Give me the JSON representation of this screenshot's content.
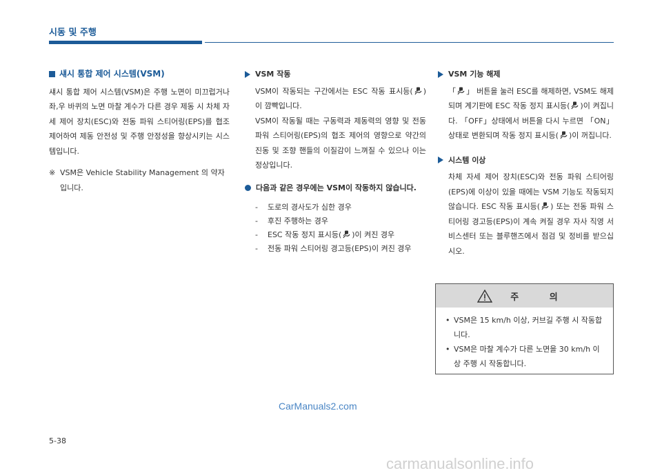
{
  "header": {
    "section": "시동 및 주행"
  },
  "left": {
    "title": "섀시 통합 제어 시스템(VSM)",
    "body": "섀시 통합 제어 시스템(VSM)은 주행 노면이 미끄럽거나 좌,우 바퀴의 노면 마찰 계수가 다른 경우 제동 시 차체 자세 제어 장치(ESC)와 전동 파워 스티어링(EPS)를 협조 제어하여 제동 안전성 및 주행 안정성을 향상시키는 시스템입니다.",
    "note_mark": "※",
    "note": "VSM은 Vehicle Stability Management 의 약자입니다."
  },
  "middle": {
    "title": "VSM 작동",
    "p1a": "VSM이 작동되는 구간에서는 ESC 작동 표시등(",
    "p1b": ")이 깜빡입니다.",
    "p2": "VSM이 작동될 때는 구동력과 제동력의 영향 및 전동 파워 스티어링(EPS)의 협조 제어의 영향으로 약간의 진동 및 조향 핸들의 이질감이 느껴질 수 있으나 이는 정상입니다.",
    "dot_heading": "다음과 같은 경우에는 VSM이 작동하지 않습니다.",
    "dash": "-",
    "cases": [
      "도로의 경사도가 심한 경우",
      "후진 주행하는 경우"
    ],
    "case3a": "ESC 작동 정지 표시등(",
    "case3b": ")이 켜진 경우",
    "case4": "전동 파워 스티어링 경고등(EPS)이 켜진 경우"
  },
  "right": {
    "title1": "VSM 기능 해제",
    "p1a": "「",
    "p1b": "」 버튼을 눌러 ESC를 해제하면, VSM도 해제되며 계기판에 ESC 작동 정지 표시등(",
    "p1c": ")이 켜집니다. 「OFF」상태에서 버튼을 다시 누르면 「ON」상태로 변환되며 작동 정지 표시등(",
    "p1d": ")이 꺼집니다.",
    "title2": "시스템 이상",
    "p2a": "차체 자세 제어 장치(ESC)와 전동 파워 스티어링(EPS)에 이상이 있을 때에는 VSM 기능도 작동되지 않습니다. ESC 작동 표시등(",
    "p2b": ") 또는 전동 파워 스티어링 경고등(EPS)이 계속 켜질 경우 자사 직영 서비스센터 또는 블루핸즈에서 점검 및 정비를 받으십시오."
  },
  "caution": {
    "title": "주 의",
    "bullet": "•",
    "items": [
      "VSM은 15 km/h 이상, 커브길 주행 시 작동합니다.",
      "VSM은 마찰 계수가 다른 노면을 30 km/h 이상 주행 시 작동합니다."
    ]
  },
  "footer": {
    "page_number": "5-38",
    "watermark": "CarManuals2.com",
    "site": "carmanualsonline.info"
  },
  "colors": {
    "accent": "#1c5b98",
    "caution_bg": "#d9d9d9"
  }
}
